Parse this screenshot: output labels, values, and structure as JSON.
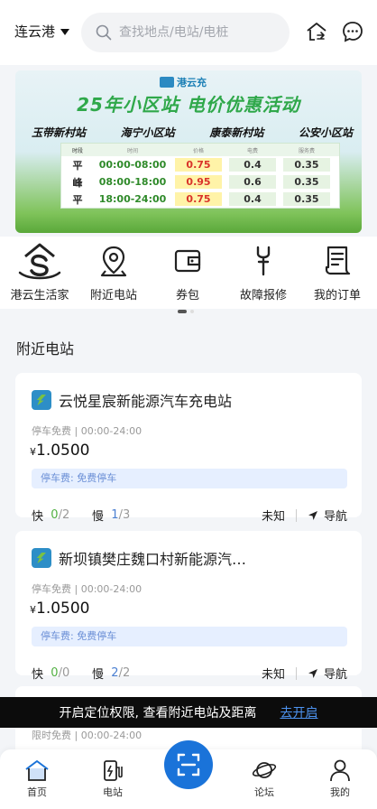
{
  "header": {
    "city": "连云港",
    "search_placeholder": "查找地点/电站/电桩"
  },
  "banner": {
    "logo_text": "港云充",
    "title": "25年小区站  电价优惠活动",
    "stations": [
      "玉带新村站",
      "海宁小区站",
      "康泰新村站",
      "公安小区站"
    ],
    "table_headers": [
      "时段",
      "时间",
      "价格",
      "电费",
      "服务费"
    ],
    "rows": [
      {
        "period": "平",
        "time": "00:00-08:00",
        "price": "0.75",
        "elec": "0.4",
        "service": "0.35"
      },
      {
        "period": "峰",
        "time": "08:00-18:00",
        "price": "0.95",
        "elec": "0.6",
        "service": "0.35"
      },
      {
        "period": "平",
        "time": "18:00-24:00",
        "price": "0.75",
        "elec": "0.4",
        "service": "0.35"
      }
    ]
  },
  "quick_menu": [
    {
      "label": "港云生活家",
      "icon": "life-icon"
    },
    {
      "label": "附近电站",
      "icon": "location-pin-icon"
    },
    {
      "label": "券包",
      "icon": "wallet-icon"
    },
    {
      "label": "故障报修",
      "icon": "wrench-icon"
    },
    {
      "label": "我的订单",
      "icon": "order-icon"
    }
  ],
  "nearby": {
    "title": "附近电站",
    "stations": [
      {
        "name": "云悦星宸新能源汽车充电站",
        "meta": "停车免费 | 00:00-24:00",
        "currency": "¥",
        "price": "1.0500",
        "tag": "停车费: 免费停车",
        "fast_label": "快",
        "fast_free": "0",
        "fast_total": "/2",
        "slow_label": "慢",
        "slow_free": "1",
        "slow_total": "/3",
        "distance": "未知",
        "nav": "导航"
      },
      {
        "name": "新坝镇樊庄魏口村新能源汽…",
        "meta": "停车免费 | 00:00-24:00",
        "currency": "¥",
        "price": "1.0500",
        "tag": "停车费: 免费停车",
        "fast_label": "快",
        "fast_free": "0",
        "fast_total": "/0",
        "slow_label": "慢",
        "slow_free": "2",
        "slow_total": "/2",
        "distance": "未知",
        "nav": "导航"
      }
    ],
    "partial_meta": "限时免费 | 00:00-24:00"
  },
  "location_prompt": {
    "text": "开启定位权限, 查看附近电站及距离",
    "link": "去开启"
  },
  "tabbar": {
    "home": "首页",
    "station": "电站",
    "forum": "论坛",
    "mine": "我的"
  },
  "colors": {
    "brand_blue": "#1a73d9",
    "fast_green": "#52b043",
    "slow_blue": "#4a7fd1",
    "banner_title_green": "#2fa84a"
  }
}
